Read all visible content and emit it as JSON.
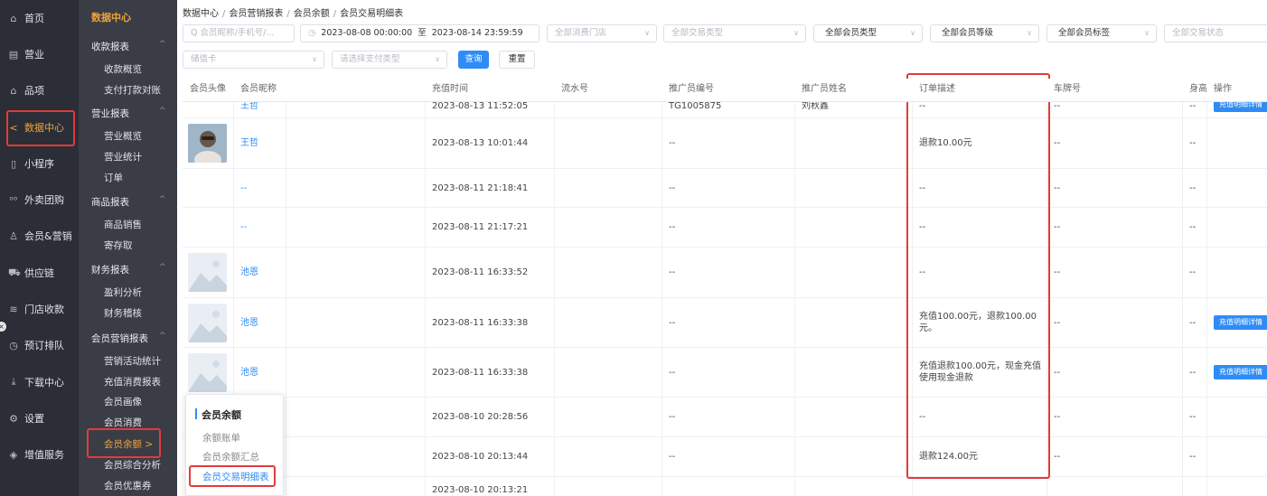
{
  "rail": {
    "items": [
      {
        "label": "首页",
        "icon": "home-icon",
        "glyph": "⌂"
      },
      {
        "label": "营业",
        "icon": "store-icon",
        "glyph": "▤"
      },
      {
        "label": "品项",
        "icon": "bag-icon",
        "glyph": "⌂"
      },
      {
        "label": "数据中心",
        "icon": "share-icon",
        "glyph": "<"
      },
      {
        "label": "小程序",
        "icon": "phone-icon",
        "glyph": "▯"
      },
      {
        "label": "外卖团购",
        "icon": "bike-icon",
        "glyph": "ᵒᵒ"
      },
      {
        "label": "会员&营销",
        "icon": "user-icon",
        "glyph": "♙"
      },
      {
        "label": "供应链",
        "icon": "truck-icon",
        "glyph": "⛟"
      },
      {
        "label": "门店收款",
        "icon": "coins-icon",
        "glyph": "≋"
      },
      {
        "label": "预订排队",
        "icon": "clock-icon",
        "glyph": "◷"
      },
      {
        "label": "下载中心",
        "icon": "download-icon",
        "glyph": "⤓"
      },
      {
        "label": "设置",
        "icon": "gear-icon",
        "glyph": "⚙"
      },
      {
        "label": "增值服务",
        "icon": "gem-icon",
        "glyph": "◈"
      }
    ],
    "collapse_glyph": "×"
  },
  "submenu": {
    "title": "数据中心",
    "groups": [
      {
        "label": "收款报表",
        "items": [
          "收款概览",
          "支付打款对账"
        ]
      },
      {
        "label": "营业报表",
        "items": [
          "营业概览",
          "营业统计",
          "订单"
        ]
      },
      {
        "label": "商品报表",
        "items": [
          "商品销售",
          "寄存取"
        ]
      },
      {
        "label": "财务报表",
        "items": [
          "盈利分析",
          "财务稽核"
        ]
      },
      {
        "label": "会员营销报表",
        "items": [
          "营销活动统计",
          "充值消费报表",
          "会员画像",
          "会员消费",
          "会员余额 >",
          "会员综合分析",
          "会员优惠券"
        ]
      }
    ],
    "caret": "^"
  },
  "breadcrumb": [
    "数据中心",
    "会员营销报表",
    "会员余额",
    "会员交易明细表"
  ],
  "breadcrumb_sep": "/",
  "filters": {
    "member_search_placeholder": "会员昵称/手机号/...",
    "date_start": "2023-08-08 00:00:00",
    "date_to": "至",
    "date_end": "2023-08-14 23:59:59",
    "store": "全部消费门店",
    "trade_type": "全部交易类型",
    "member_type": "全部会员类型",
    "member_level": "全部会员等级",
    "member_tag": "全部会员标签",
    "trade_status": "全部交易状态",
    "card": "储值卡",
    "pay_type": "请选择支付类型",
    "query": "查询",
    "reset": "重置",
    "arrow": "∨",
    "search_glyph": "Q",
    "clock_glyph": "◷"
  },
  "table": {
    "columns": [
      "会员头像",
      "会员昵称",
      "充值时间",
      "流水号",
      "推广员编号",
      "推广员姓名",
      "订单描述",
      "车牌号",
      "身高",
      "操作"
    ],
    "partial_row": {
      "nickname": "王哲",
      "time": "2023-08-13 11:52:05",
      "promoter_no": "TG1005875",
      "promoter_name": "刘秋鑫",
      "desc": "--",
      "plate": "--",
      "height": "--",
      "op": "充值明细详情"
    },
    "rows": [
      {
        "avatar": "photo",
        "nickname": "王哲",
        "time": "2023-08-13 10:01:44",
        "serial": "",
        "promoter_no": "--",
        "promoter_name": "",
        "desc": "退款10.00元",
        "plate": "--",
        "height": "--",
        "op": ""
      },
      {
        "avatar": "",
        "nickname": "--",
        "time": "2023-08-11 21:18:41",
        "serial": "",
        "promoter_no": "--",
        "promoter_name": "",
        "desc": "--",
        "plate": "--",
        "height": "--",
        "op": ""
      },
      {
        "avatar": "",
        "nickname": "--",
        "time": "2023-08-11 21:17:21",
        "serial": "",
        "promoter_no": "--",
        "promoter_name": "",
        "desc": "--",
        "plate": "--",
        "height": "--",
        "op": ""
      },
      {
        "avatar": "placeholder",
        "nickname": "池恩",
        "time": "2023-08-11 16:33:52",
        "serial": "",
        "promoter_no": "--",
        "promoter_name": "",
        "desc": "--",
        "plate": "--",
        "height": "--",
        "op": ""
      },
      {
        "avatar": "placeholder",
        "nickname": "池恩",
        "time": "2023-08-11 16:33:38",
        "serial": "",
        "promoter_no": "--",
        "promoter_name": "",
        "desc": "充值100.00元，退款100.00元。",
        "plate": "--",
        "height": "--",
        "op": "充值明细详情"
      },
      {
        "avatar": "placeholder",
        "nickname": "池恩",
        "time": "2023-08-11 16:33:38",
        "serial": "",
        "promoter_no": "--",
        "promoter_name": "",
        "desc": "充值退款100.00元，现金充值使用现金退款",
        "plate": "--",
        "height": "--",
        "op": "充值明细详情"
      },
      {
        "avatar": "",
        "nickname": "",
        "time": "2023-08-10 20:28:56",
        "serial": "",
        "promoter_no": "--",
        "promoter_name": "",
        "desc": "--",
        "plate": "--",
        "height": "--",
        "op": ""
      },
      {
        "avatar": "",
        "nickname": "",
        "time": "2023-08-10 20:13:44",
        "serial": "",
        "promoter_no": "--",
        "promoter_name": "",
        "desc": "退款124.00元",
        "plate": "--",
        "height": "--",
        "op": ""
      },
      {
        "avatar": "",
        "nickname": "",
        "time": "2023-08-10 20:13:21",
        "serial": "",
        "promoter_no": "",
        "promoter_name": "",
        "desc": "",
        "plate": "",
        "height": "",
        "op": ""
      }
    ]
  },
  "popover": {
    "title": "会员余额",
    "items": [
      "余额账单",
      "会员余额汇总",
      "会员交易明细表"
    ]
  },
  "colors": {
    "accent": "#2f8cf4",
    "active": "#f1a33a",
    "highlight": "#e23b3b",
    "rail_bg": "#2b2e36",
    "submenu_bg": "#3a3d45"
  }
}
